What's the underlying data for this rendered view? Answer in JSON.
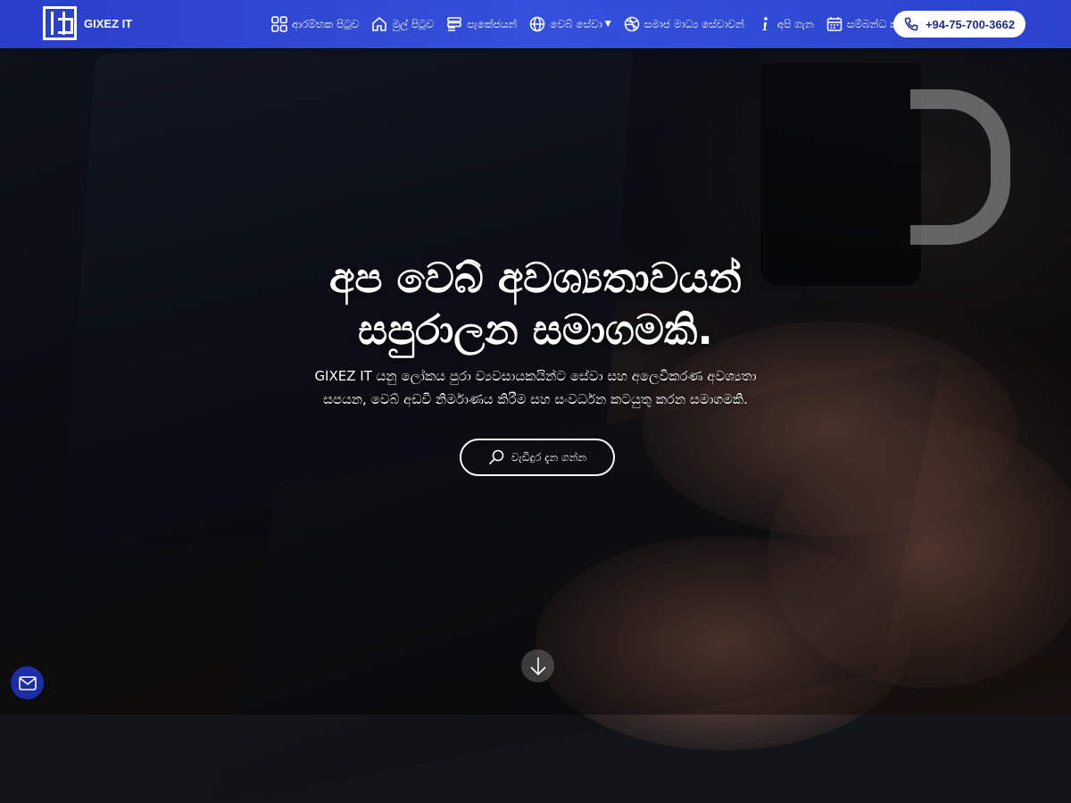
{
  "brand": {
    "name": "GIXEZ IT",
    "logo_icon": "gixez-logo-icon"
  },
  "nav": {
    "items": [
      {
        "label": "ආරම්භක පිටුව",
        "icon": "grid-icon"
      },
      {
        "label": "මුල් පිටුව",
        "icon": "home-icon"
      },
      {
        "label": "පැකේජයන්",
        "icon": "server-icon"
      },
      {
        "label": "වෙබ් සේවා",
        "icon": "globe-icon",
        "dropdown": true
      },
      {
        "label": "සමාජ මාධ්‍ය සේවාවන්",
        "icon": "dribbble-icon"
      },
      {
        "label": "අපි ගැන",
        "icon": "info-icon"
      },
      {
        "label": "සම්බන්ධ කරගැනීම්",
        "icon": "calendar-icon"
      }
    ],
    "phone": "+94-75-700-3662"
  },
  "hero": {
    "title_line1": "අප වෙබ් අවශ්‍යතාවයන්",
    "title_line2": "සපුරාලන සමාගමකි.",
    "subtitle_line1": "GIXEZ IT යනු ලෝකය පුරා ව්‍යවසායකයින්ට සේවා සහ අලෙවිකරණ අවශ්‍යතා",
    "subtitle_line2": "සපයන, වෙබ් අඩවි නිර්මාණය කිරීම සහ සංවර්ධන කටයුතු කරන සමාගමකි.",
    "cta_label": "වැඩිදුර දැන ගන්න",
    "cta_icon": "search-icon"
  },
  "colors": {
    "navbar": "#3450dc",
    "accent": "#1d2da8",
    "text": "#ffffff"
  }
}
